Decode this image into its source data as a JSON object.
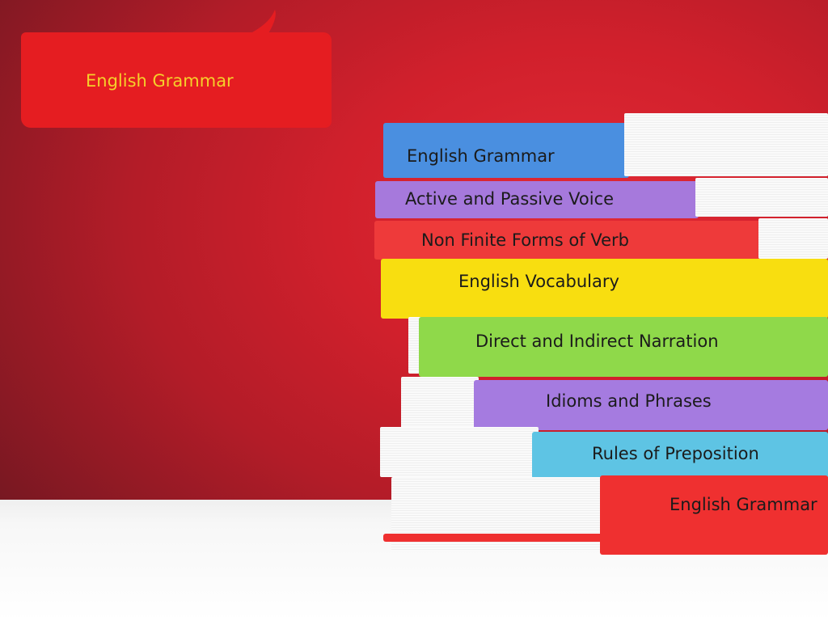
{
  "bubble": {
    "title": "English Grammar"
  },
  "books": [
    {
      "label": "English Grammar",
      "color": "#4a8fe0"
    },
    {
      "label": "Active and Passive Voice",
      "color": "#a679dc"
    },
    {
      "label": "Non Finite Forms of Verb",
      "color": "#ee3a3a"
    },
    {
      "label": "English Vocabulary",
      "color": "#f8de10"
    },
    {
      "label": "Direct and Indirect Narration",
      "color": "#8fd94a"
    },
    {
      "label": "Idioms and Phrases",
      "color": "#a57be0"
    },
    {
      "label": "Rules of Preposition",
      "color": "#5ec4e4"
    },
    {
      "label": "English Grammar",
      "color": "#ef3030"
    }
  ]
}
